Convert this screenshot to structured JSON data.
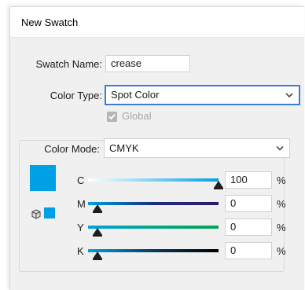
{
  "dialog": {
    "title": "New Swatch"
  },
  "form": {
    "swatch_name_label": "Swatch Name:",
    "swatch_name_value": "crease",
    "color_type_label": "Color Type:",
    "color_type_value": "Spot Color",
    "global_label": "Global",
    "global_checked": true,
    "global_enabled": false
  },
  "color_mode": {
    "label": "Color Mode:",
    "value": "CMYK",
    "swatch_color": "#00a0e4",
    "channels": [
      {
        "key": "C",
        "value": "100",
        "unit": "%",
        "level": 100
      },
      {
        "key": "M",
        "value": "0",
        "unit": "%",
        "level": 0
      },
      {
        "key": "Y",
        "value": "0",
        "unit": "%",
        "level": 0
      },
      {
        "key": "K",
        "value": "0",
        "unit": "%",
        "level": 0
      }
    ]
  },
  "icons": {
    "global_check": "check-icon",
    "out_of_gamut": "cube-icon",
    "dropdown": "chevron-down-icon"
  }
}
